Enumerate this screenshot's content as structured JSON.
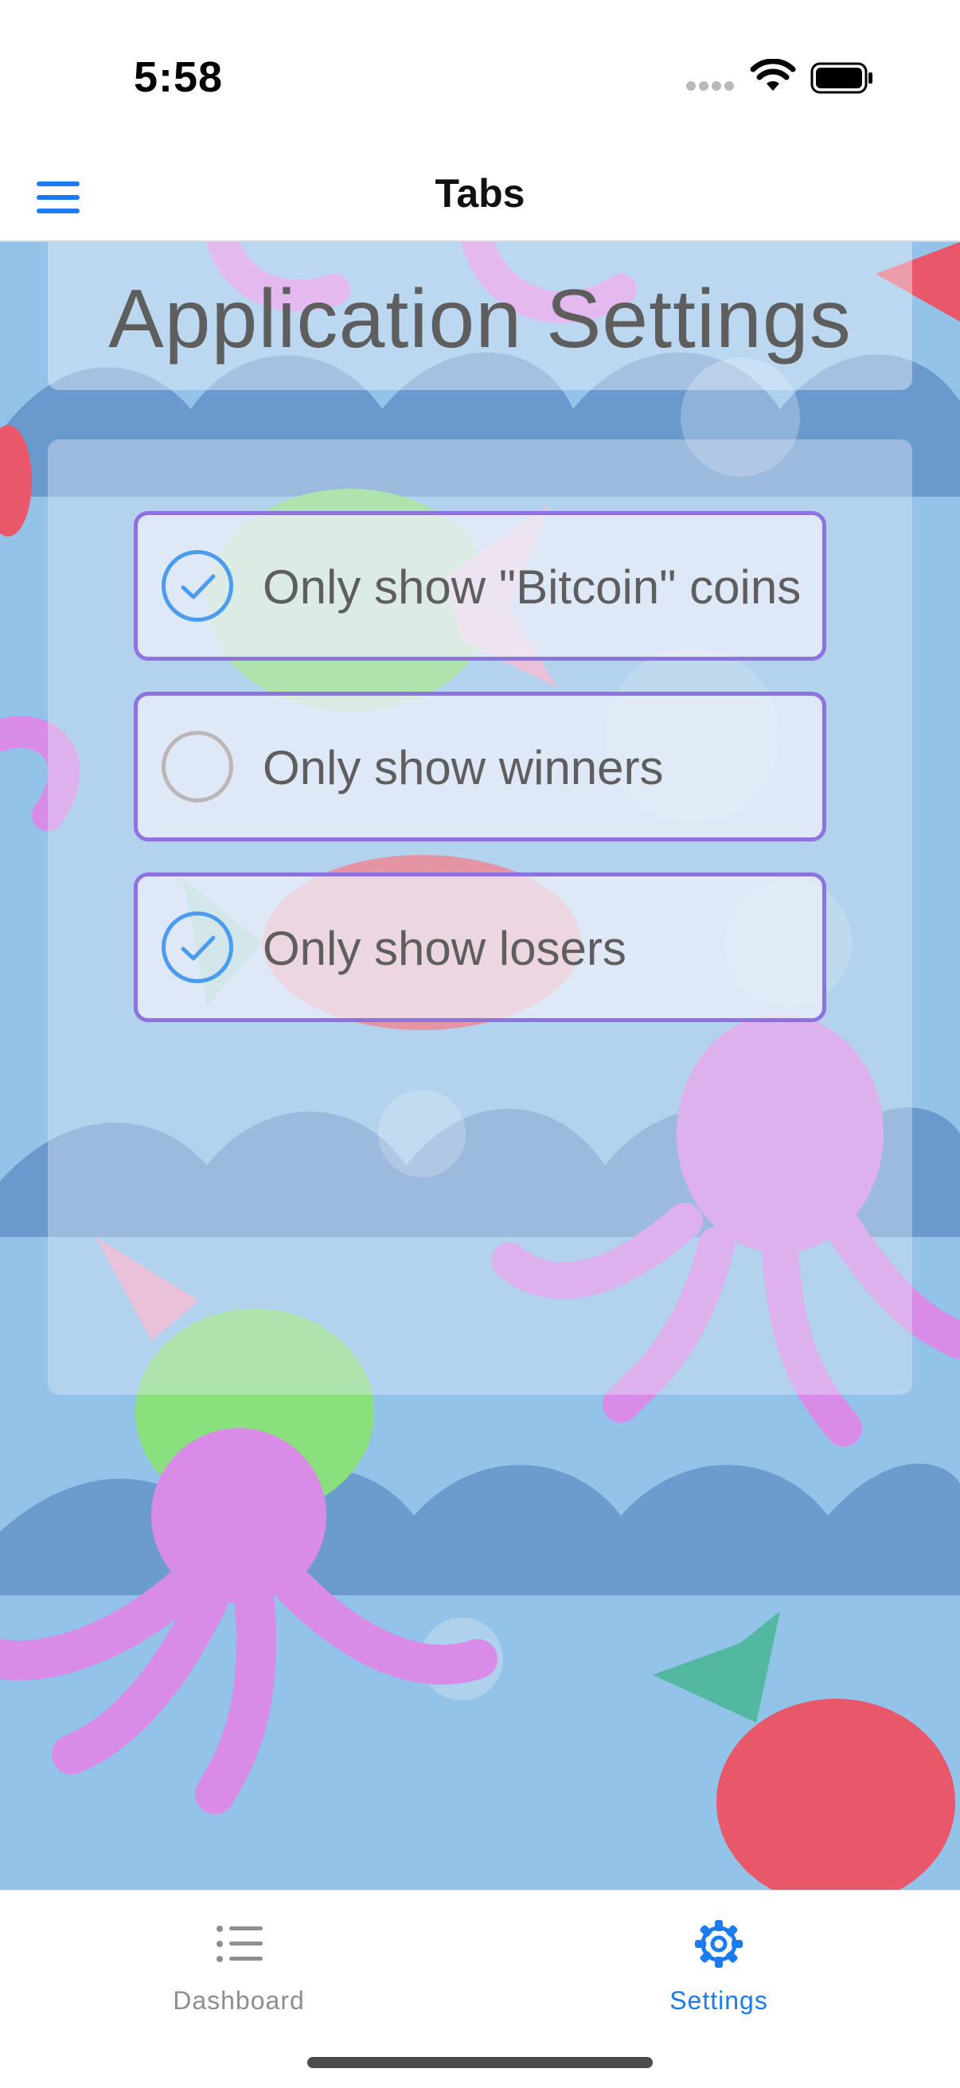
{
  "status_bar": {
    "time": "5:58"
  },
  "nav": {
    "title": "Tabs",
    "menu_icon": "hamburger-menu-icon"
  },
  "page": {
    "title": "Application Settings"
  },
  "settings": {
    "options": [
      {
        "label": "Only show \"Bitcoin\" coins",
        "checked": true
      },
      {
        "label": "Only show winners",
        "checked": false
      },
      {
        "label": "Only show losers",
        "checked": true
      }
    ]
  },
  "tab_bar": {
    "tabs": [
      {
        "label": "Dashboard",
        "icon": "list-icon",
        "active": false
      },
      {
        "label": "Settings",
        "icon": "gear-icon",
        "active": true
      }
    ]
  },
  "colors": {
    "accent": "#1a7cf0",
    "option_border": "#8d72e0",
    "checkbox_checked": "#4a9cef",
    "checkbox_unchecked": "#bdb6b6",
    "background_water": "#93c3e8"
  }
}
